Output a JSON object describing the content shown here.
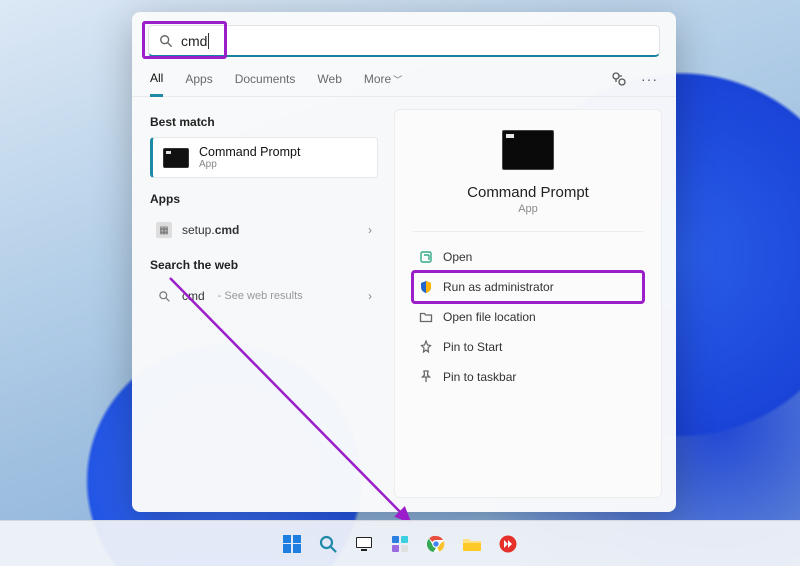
{
  "search": {
    "value": "cmd"
  },
  "tabs": [
    "All",
    "Apps",
    "Documents",
    "Web",
    "More"
  ],
  "left": {
    "best_match_label": "Best match",
    "best_item": {
      "title": "Command Prompt",
      "subtitle": "App"
    },
    "apps_label": "Apps",
    "app_item": {
      "title": "setup.cmd"
    },
    "web_label": "Search the web",
    "web_item": {
      "query": "cmd",
      "hint": "- See web results"
    }
  },
  "right": {
    "title": "Command Prompt",
    "subtitle": "App",
    "actions": {
      "open": "Open",
      "run_admin": "Run as administrator",
      "open_location": "Open file location",
      "pin_start": "Pin to Start",
      "pin_taskbar": "Pin to taskbar"
    }
  },
  "taskbar": {
    "items": [
      "start",
      "search",
      "task-view",
      "widgets",
      "chrome",
      "explorer",
      "anydesk"
    ]
  }
}
